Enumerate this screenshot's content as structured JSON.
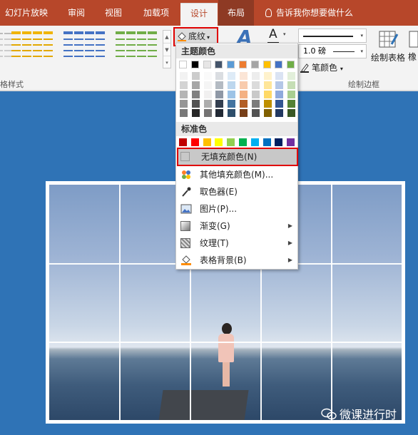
{
  "tabs": [
    {
      "label": "幻灯片放映"
    },
    {
      "label": "审阅"
    },
    {
      "label": "视图"
    },
    {
      "label": "加载项"
    },
    {
      "label": "设计"
    },
    {
      "label": "布局"
    }
  ],
  "tell_me": "告诉我你想要做什么",
  "ribbon": {
    "table_styles_label": "格样式",
    "draw_borders_label": "绘制边框",
    "shading_label": "底纹",
    "line_weight": "1.0 磅",
    "pen_color_label": "笔颜色",
    "draw_table_label": "绘制表格",
    "eraser_label": "橡"
  },
  "menu": {
    "theme_colors_header": "主题颜色",
    "standard_colors_header": "标准色",
    "no_fill": "无填充颜色(N)",
    "more_fill": "其他填充颜色(M)...",
    "eyedropper": "取色器(E)",
    "picture": "图片(P)...",
    "gradient": "渐变(G)",
    "texture": "纹理(T)",
    "table_background": "表格背景(B)"
  },
  "theme_colors": [
    "#ffffff",
    "#000000",
    "#e7e6e6",
    "#44546a",
    "#5b9bd5",
    "#ed7d31",
    "#a5a5a5",
    "#ffc000",
    "#4472c4",
    "#70ad47"
  ],
  "standard_colors": [
    "#c00000",
    "#ff0000",
    "#ffc000",
    "#ffff00",
    "#92d050",
    "#00b050",
    "#00b0f0",
    "#0070c0",
    "#002060",
    "#7030a0"
  ],
  "watermark": "微课进行时",
  "colors": {
    "accent_tab": "#b7472a",
    "highlight_box": "#e00000",
    "slide_bg": "#2f73b6"
  }
}
